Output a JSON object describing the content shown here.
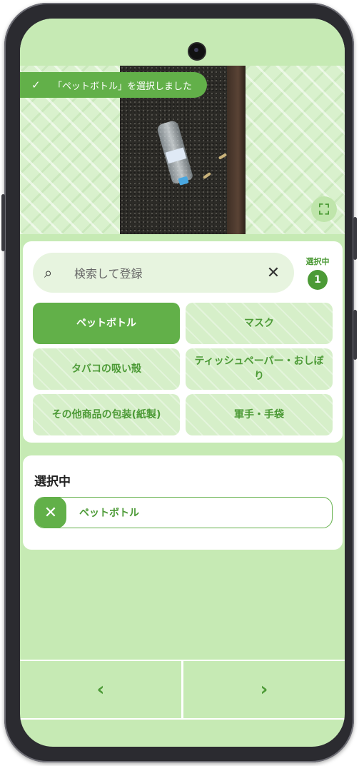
{
  "toast": {
    "check_icon": "✓",
    "text": "「ペットボトル」を選択しました"
  },
  "fullscreen_icon": "⛶",
  "search": {
    "icon": "⌕",
    "placeholder": "検索して登録",
    "clear_icon": "✕"
  },
  "selection_counter": {
    "label": "選択中",
    "count": "1"
  },
  "categories": [
    {
      "label": "ペットボトル",
      "selected": true
    },
    {
      "label": "マスク",
      "selected": false
    },
    {
      "label": "タバコの吸い殻",
      "selected": false
    },
    {
      "label": "ティッシュペーパー・おしぼり",
      "selected": false
    },
    {
      "label": "その他商品の包装(紙製)",
      "selected": false
    },
    {
      "label": "軍手・手袋",
      "selected": false
    }
  ],
  "selected_panel": {
    "title": "選択中",
    "items": [
      {
        "remove_icon": "✕",
        "label": "ペットボトル"
      }
    ]
  },
  "navigation": {
    "prev_icon": "‹",
    "next_icon": "›"
  },
  "colors": {
    "accent": "#62b049",
    "accent_dark": "#4c9a36",
    "background": "#c6eab4",
    "chip": "#d6efc9"
  }
}
